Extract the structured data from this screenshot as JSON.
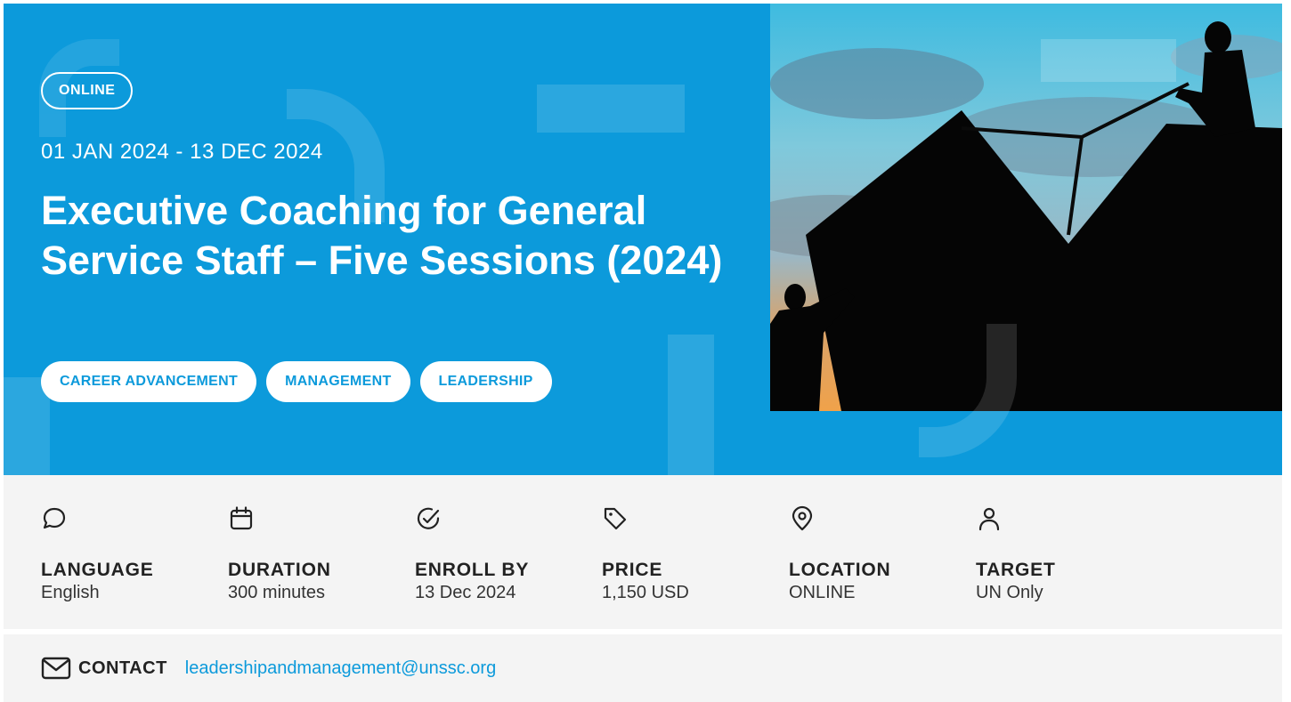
{
  "hero": {
    "badge": "ONLINE",
    "dates": "01 JAN 2024 - 13 DEC 2024",
    "title": "Executive Coaching for General Service Staff – Five Sessions (2024)",
    "tags": [
      "CAREER ADVANCEMENT",
      "MANAGEMENT",
      "LEADERSHIP"
    ],
    "photo_icon": "climbing-silhouette-image"
  },
  "facts": [
    {
      "icon": "chat-bubble-icon",
      "label": "LANGUAGE",
      "value": "English"
    },
    {
      "icon": "calendar-icon",
      "label": "DURATION",
      "value": "300 minutes"
    },
    {
      "icon": "check-circle-icon",
      "label": "ENROLL BY",
      "value": "13 Dec 2024"
    },
    {
      "icon": "price-tag-icon",
      "label": "PRICE",
      "value": "1,150 USD"
    },
    {
      "icon": "location-pin-icon",
      "label": "LOCATION",
      "value": "ONLINE"
    },
    {
      "icon": "user-icon",
      "label": "TARGET",
      "value": "UN Only"
    }
  ],
  "contact": {
    "icon": "mail-icon",
    "label": "CONTACT",
    "email": "leadershipandmanagement@unssc.org"
  },
  "colors": {
    "brand_blue": "#0C9ADB",
    "panel_gray": "#F4F4F4",
    "text_dark": "#222222"
  }
}
